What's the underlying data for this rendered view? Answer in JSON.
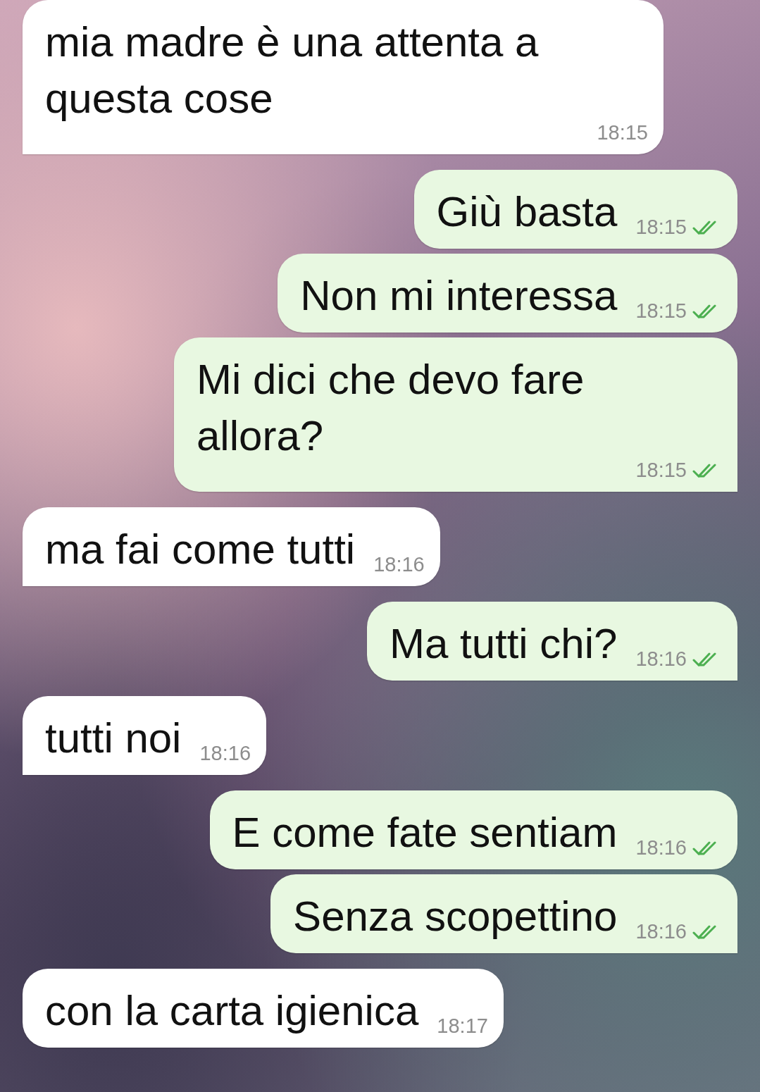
{
  "messages": [
    {
      "kind": "incoming",
      "text": "mia madre è una attenta a questa cose",
      "time": "18:15",
      "tail": true
    },
    {
      "kind": "outgoing",
      "text": "Giù basta",
      "time": "18:15",
      "tail": false,
      "read": true
    },
    {
      "kind": "outgoing",
      "text": "Non mi interessa",
      "time": "18:15",
      "tail": false,
      "read": true
    },
    {
      "kind": "outgoing",
      "text": "Mi dici che devo fare allora?",
      "time": "18:15",
      "tail": true,
      "read": true
    },
    {
      "kind": "incoming",
      "text": "ma fai come tutti",
      "time": "18:16",
      "tail": true
    },
    {
      "kind": "outgoing",
      "text": "Ma tutti chi?",
      "time": "18:16",
      "tail": true,
      "read": true
    },
    {
      "kind": "incoming",
      "text": "tutti noi",
      "time": "18:16",
      "tail": true
    },
    {
      "kind": "outgoing",
      "text": "E come fate sentiam",
      "time": "18:16",
      "tail": false,
      "read": true
    },
    {
      "kind": "outgoing",
      "text": "Senza scopettino",
      "time": "18:16",
      "tail": true,
      "read": true
    },
    {
      "kind": "incoming",
      "text": "con la carta igienica",
      "time": "18:17",
      "tail": false
    }
  ]
}
